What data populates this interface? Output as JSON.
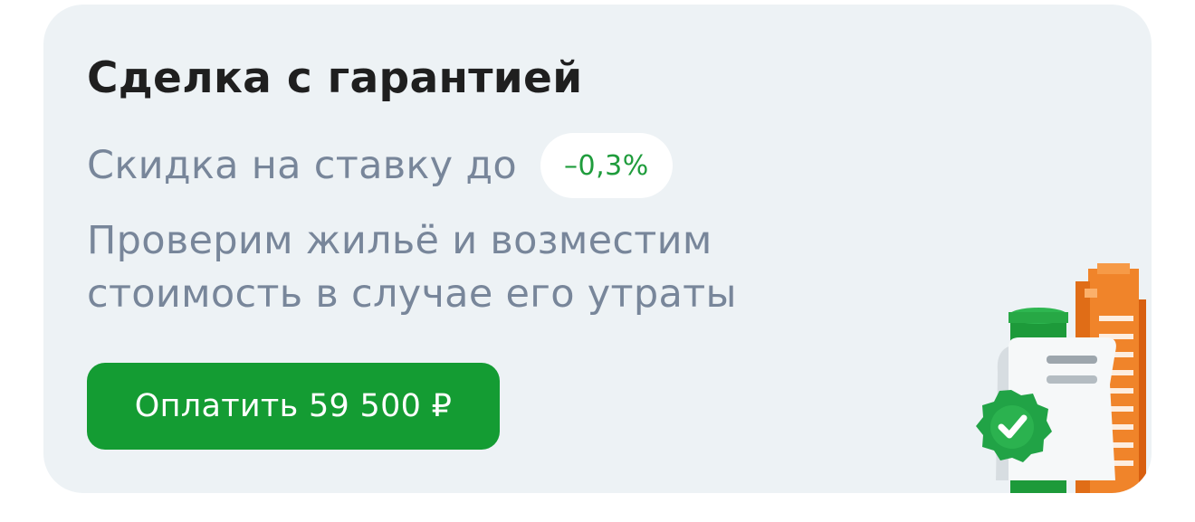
{
  "offer": {
    "title": "Сделка с гарантией",
    "discount_label": "Скидка на ставку до",
    "discount_value": "–0,3%",
    "description": "Проверим жильё и возместим стоимость в случае его утраты",
    "pay_button_label": "Оплатить 59 500 ₽",
    "illustration_icon": "document-guarantee-building-icon"
  },
  "colors": {
    "card_background": "#edf2f5",
    "title": "#1f1f1f",
    "secondary_text": "#78869a",
    "accent_green": "#149c33",
    "discount_text": "#1f9c3c",
    "building_orange": "#f0842a"
  }
}
